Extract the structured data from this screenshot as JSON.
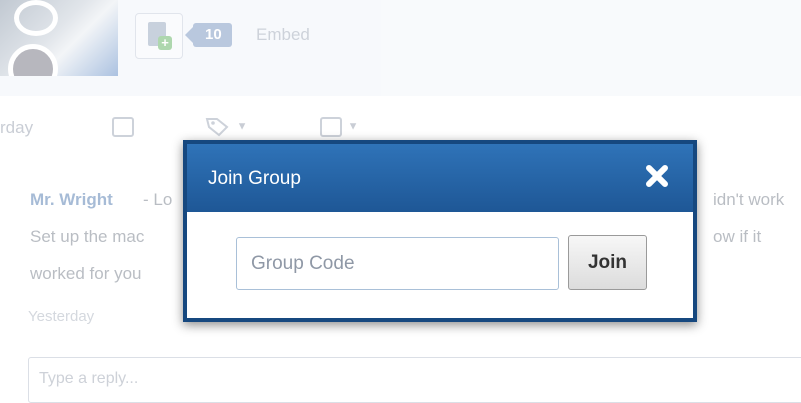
{
  "background": {
    "resource_count": "10",
    "embed_label": "Embed",
    "timestamp_label": "rday",
    "post": {
      "author": "Mr. Wright",
      "line1_left": "- Lo",
      "line1_right": "idn't work",
      "line2_left": "Set up the mac",
      "line2_right": "ow if it",
      "line3_left": "worked for you",
      "time": "Yesterday"
    },
    "reply_placeholder": "Type a reply..."
  },
  "modal": {
    "title": "Join Group",
    "input_placeholder": "Group Code",
    "input_value": "",
    "join_label": "Join",
    "header_color": "#2466a8",
    "border_color": "#16487f"
  },
  "icons": [
    "close-icon",
    "comment-icon",
    "tag-icon",
    "folder-icon",
    "add-resource-icon",
    "video-thumbnail"
  ]
}
